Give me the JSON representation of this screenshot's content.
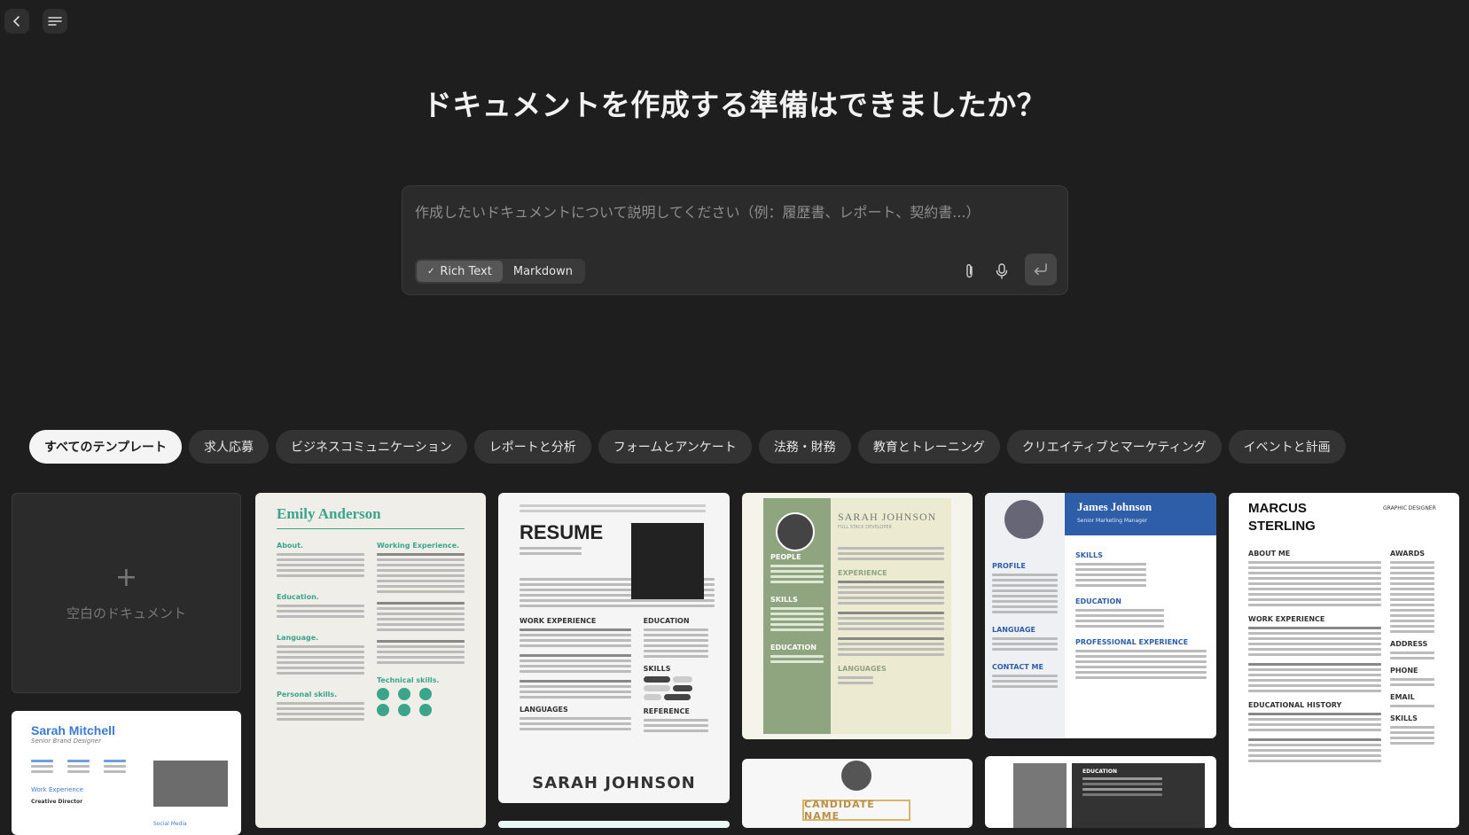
{
  "heading": "ドキュメントを作成する準備はできましたか？",
  "composer": {
    "placeholder": "作成したいドキュメントについて説明してください（例：履歴書、レポート、契約書...）",
    "format_rich": "Rich Text",
    "format_md": "Markdown"
  },
  "categories": [
    "すべてのテンプレート",
    "求人応募",
    "ビジネスコミュニケーション",
    "レポートと分析",
    "フォームとアンケート",
    "法務・財務",
    "教育とトレーニング",
    "クリエイティブとマーケティング",
    "イベントと計画"
  ],
  "blank_label": "空白のドキュメント",
  "templates": {
    "emily": {
      "name": "Emily Anderson",
      "about": "About.",
      "work": "Working Experience.",
      "edu": "Education.",
      "lang": "Language.",
      "tech": "Technical skills.",
      "personal": "Personal skills."
    },
    "resume": {
      "title": "RESUME",
      "work": "WORK EXPERIENCE",
      "edu": "EDUCATION",
      "skills": "SKILLS",
      "lang": "LANGUAGES",
      "ref": "REFERENCE",
      "footer": "SARAH JOHNSON"
    },
    "sarahj": {
      "name": "SARAH JOHNSON",
      "role": "FULL STACK DEVELOPER",
      "people": "PEOPLE",
      "exp": "EXPERIENCE",
      "skills": "SKILLS",
      "edu": "EDUCATION",
      "lang": "LANGUAGES"
    },
    "james": {
      "name": "James Johnson",
      "role": "Senior Marketing Manager",
      "profile": "PROFILE",
      "skills": "SKILLS",
      "edu": "EDUCATION",
      "exp": "PROFESSIONAL EXPERIENCE",
      "lang": "LANGUAGE",
      "contact": "CONTACT ME"
    },
    "marcus": {
      "name1": "MARCUS",
      "name2": "STERLING",
      "role": "GRAPHIC DESIGNER",
      "about": "ABOUT ME",
      "work": "WORK EXPERIENCE",
      "edu": "EDUCATIONAL HISTORY",
      "awards": "AWARDS",
      "address": "ADDRESS",
      "phone": "PHONE",
      "email": "EMAIL",
      "skills": "SKILLS"
    },
    "sarahm": {
      "name": "Sarah Mitchell",
      "role": "Senior Brand Designer",
      "work": "Work Experience",
      "social": "Social Media",
      "job": "Creative Director"
    },
    "candidate": {
      "name": "CANDIDATE NAME"
    },
    "edu_card": {
      "label": "EDUCATION"
    }
  }
}
